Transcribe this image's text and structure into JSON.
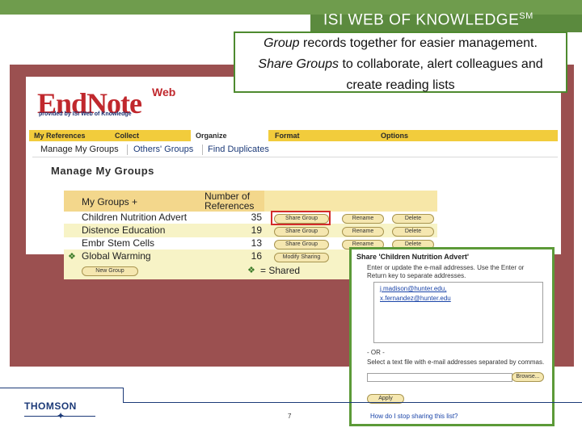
{
  "header": {
    "brand": "ISI WEB OF KNOWLEDGE",
    "brand_sup": "SM"
  },
  "callout": {
    "line1_em": "Group",
    "line1_rest": " records together for easier management.",
    "line2_em": "Share Groups",
    "line2_rest": " to collaborate, alert colleagues and",
    "line3": "create reading lists"
  },
  "app": {
    "logo": "EndNote",
    "logo_web": "Web",
    "logo_sub": "provided by ISI Web of Knowledge",
    "nav_tabs": [
      "My References",
      "Collect",
      "Organize",
      "Format",
      "Options"
    ],
    "active_tab": "Organize",
    "subnav": [
      "Manage My Groups",
      "Others' Groups",
      "Find Duplicates"
    ],
    "page_title": "Manage My Groups"
  },
  "groups_table": {
    "col_group": "My Groups",
    "col_group_sort": "+",
    "col_count_line1": "Number of",
    "col_count_line2": "References",
    "rows": [
      {
        "name": "Children Nutrition Advert",
        "count": "35",
        "share": "Share Group",
        "rename": "Rename",
        "delete": "Delete"
      },
      {
        "name": "Distence Education",
        "count": "19",
        "share": "Share Group",
        "rename": "Rename",
        "delete": "Delete"
      },
      {
        "name": "Embr Stem Cells",
        "count": "13",
        "share": "Share Group",
        "rename": "Rename",
        "delete": "Delete"
      },
      {
        "name": "Global Warming",
        "count": "16",
        "share": "Modify Sharing",
        "rename": "Rename",
        "delete": "Delete"
      }
    ],
    "new_group": "New Group",
    "shared_legend": "= Shared"
  },
  "share_dialog": {
    "title": "Share 'Children Nutrition Advert'",
    "instructions": "Enter or update the e-mail addresses. Use the Enter or Return key to separate addresses.",
    "emails": [
      "j.madison@hunter.edu,",
      "x.fernandez@hunter.edu"
    ],
    "or_label": "- OR -",
    "file_instructions": "Select a text file with e-mail addresses separated by commas.",
    "browse": "Browse...",
    "apply": "Apply",
    "help_link": "How do I stop sharing this list?"
  },
  "footer": {
    "company": "THOMSON",
    "page_number": "7"
  },
  "colors": {
    "slide_green": "#5b8a3e",
    "endnote_red": "#c0282d",
    "nav_yellow": "#f2cc3c",
    "highlight_red": "#d32b2b"
  }
}
